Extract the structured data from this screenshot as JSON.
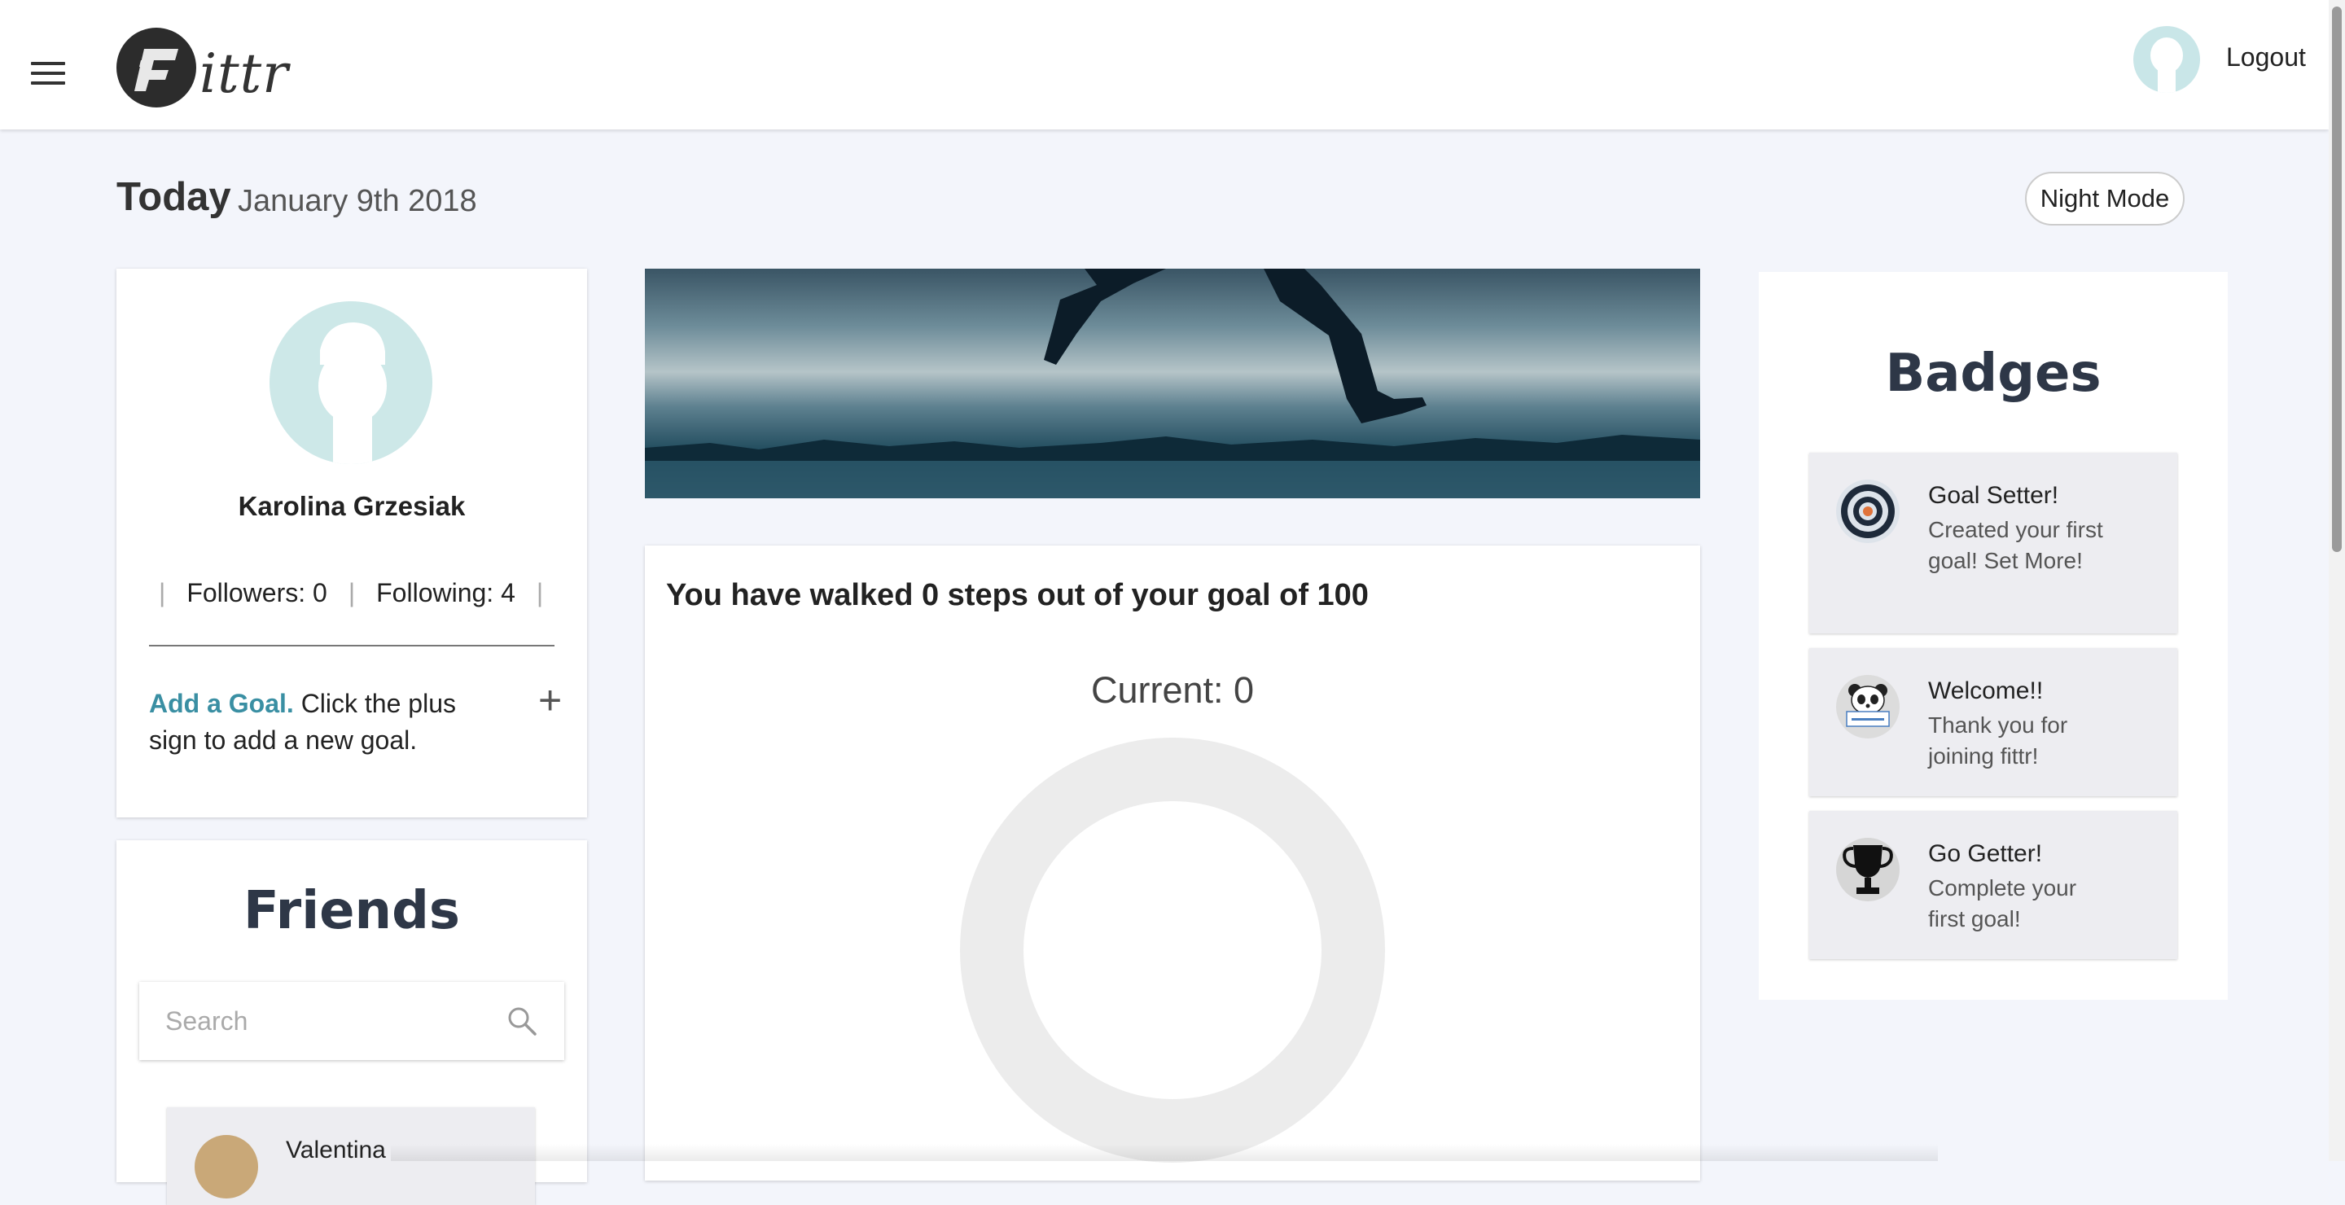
{
  "header": {
    "logo_text": "ittr",
    "logout_label": "Logout"
  },
  "page": {
    "today_label": "Today",
    "date": "January 9th 2018",
    "night_mode_label": "Night Mode"
  },
  "profile": {
    "name": "Karolina Grzesiak",
    "followers_label": "Followers: 0",
    "following_label": "Following: 4",
    "add_goal_link": "Add a Goal.",
    "add_goal_text": " Click the plus sign to add a new goal.",
    "plus_symbol": "+"
  },
  "friends": {
    "title": "Friends",
    "search_placeholder": "Search",
    "items": [
      {
        "name": "Valentina"
      }
    ]
  },
  "steps": {
    "summary": "You have walked 0 steps out of your goal of 100",
    "current_label": "Current: 0",
    "current": 0,
    "goal": 100
  },
  "badges": {
    "title": "Badges",
    "items": [
      {
        "title": "Goal Setter!",
        "description": "Created your first goal! Set More!",
        "icon": "target-icon"
      },
      {
        "title": "Welcome!!",
        "description": "Thank you for joining fittr!",
        "icon": "panda-welcome-icon"
      },
      {
        "title": "Go Getter!",
        "description": "Complete your first goal!",
        "icon": "trophy-icon"
      }
    ]
  },
  "colors": {
    "accent_link": "#3a8fa3",
    "heading": "#2e3747",
    "ring_track": "#ececec",
    "avatar_placeholder": "#cde8e8"
  }
}
